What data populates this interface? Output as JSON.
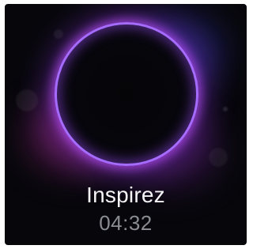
{
  "breathing": {
    "instruction": "Inspirez",
    "timer": "04:32"
  },
  "colors": {
    "ring": "#a66bff",
    "background": "#07070b",
    "instruction_text": "#f4f4f6",
    "timer_text": "#8a8c92"
  }
}
